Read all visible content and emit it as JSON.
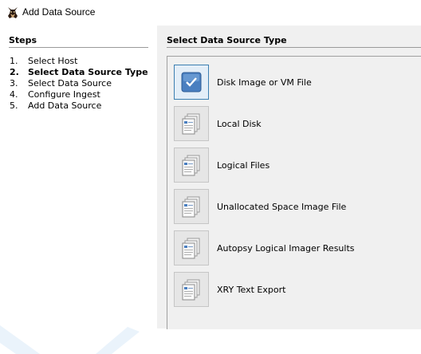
{
  "window": {
    "title": "Add Data Source",
    "icon": "autopsy-dog-icon"
  },
  "steps": {
    "title": "Steps",
    "items": [
      {
        "num": "1.",
        "label": "Select Host"
      },
      {
        "num": "2.",
        "label": "Select Data Source Type",
        "current": true
      },
      {
        "num": "3.",
        "label": "Select Data Source"
      },
      {
        "num": "4.",
        "label": "Configure Ingest"
      },
      {
        "num": "5.",
        "label": "Add Data Source"
      }
    ]
  },
  "main": {
    "title": "Select Data Source Type",
    "selected_index": 0,
    "types": [
      {
        "label": "Disk Image or VM File",
        "icon": "disk-image-icon"
      },
      {
        "label": "Local Disk",
        "icon": "local-disk-icon"
      },
      {
        "label": "Logical Files",
        "icon": "logical-files-icon"
      },
      {
        "label": "Unallocated Space Image File",
        "icon": "unallocated-space-icon"
      },
      {
        "label": "Autopsy Logical Imager Results",
        "icon": "logical-imager-icon"
      },
      {
        "label": "XRY Text Export",
        "icon": "xry-export-icon"
      }
    ]
  },
  "colors": {
    "selected_border": "#3c7fb1",
    "selected_icon": "#4a7fc0",
    "panel_bg": "#f0f0f0"
  }
}
